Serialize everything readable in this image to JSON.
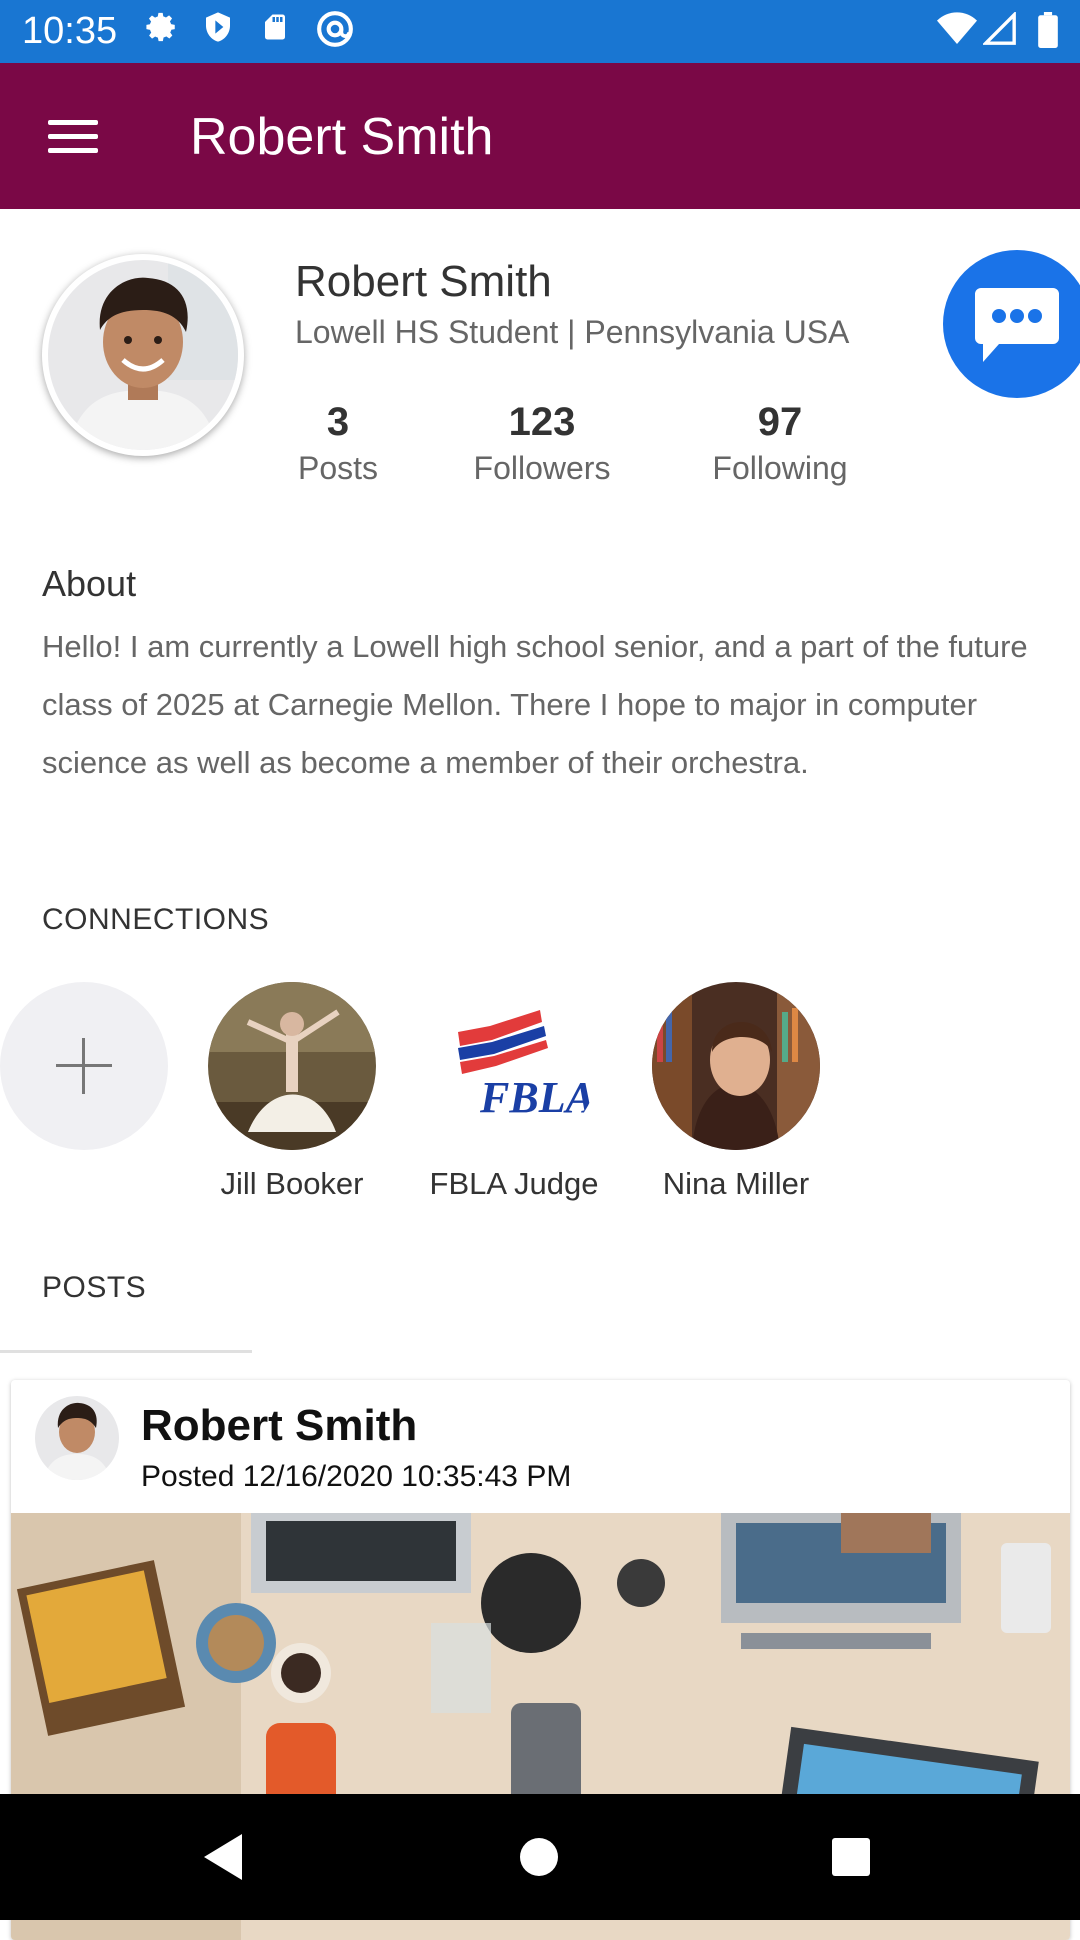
{
  "status_bar": {
    "time": "10:35",
    "left_icons": [
      "gear-icon",
      "shield-icon",
      "sd-card-icon",
      "at-sign-icon"
    ],
    "right_icons": [
      "wifi-icon",
      "signal-icon",
      "battery-icon"
    ]
  },
  "app_bar": {
    "title": "Robert Smith",
    "menu_icon": "hamburger-menu-icon"
  },
  "profile": {
    "name": "Robert Smith",
    "subtitle": "Lowell HS Student | Pennsylvania USA",
    "stats": [
      {
        "value": "3",
        "label": "Posts"
      },
      {
        "value": "123",
        "label": "Followers"
      },
      {
        "value": "97",
        "label": "Following"
      }
    ],
    "message_icon": "chat-bubble-icon"
  },
  "about": {
    "heading": "About",
    "text": "Hello! I am currently a Lowell high school senior, and a part of the future class of 2025 at Carnegie Mellon. There I hope to major in computer science as well as become a member of their orchestra."
  },
  "connections": {
    "heading": "CONNECTIONS",
    "add_icon": "plus-icon",
    "items": [
      {
        "name": "Jill Booker"
      },
      {
        "name": "FBLA Judge",
        "logo_text": "FBLA"
      },
      {
        "name": "Nina Miller"
      }
    ]
  },
  "posts": {
    "heading": "POSTS",
    "items": [
      {
        "author": "Robert Smith",
        "posted": "Posted 12/16/2020 10:35:43 PM"
      }
    ]
  },
  "nav_bar": {
    "icons": [
      "back-icon",
      "home-icon",
      "recents-icon"
    ]
  },
  "colors": {
    "status_bar": "#1976d2",
    "app_bar": "#7a0846",
    "fab": "#1a73e8"
  }
}
